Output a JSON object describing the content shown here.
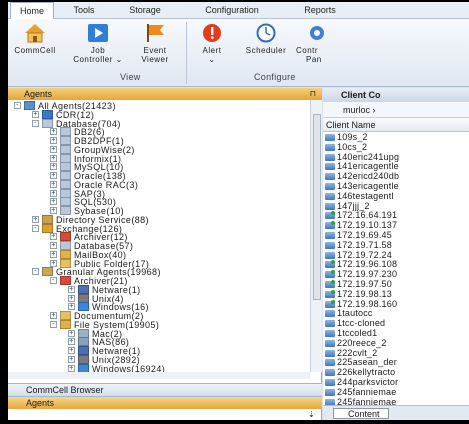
{
  "menu": [
    "Home",
    "Tools",
    "Storage",
    "Configuration",
    "Reports"
  ],
  "ribbon": {
    "buttons": [
      {
        "line1": "CommCell",
        "line2": "",
        "icon": "house-icon"
      },
      {
        "line1": "Job",
        "line2": "Controller ⌄",
        "icon": "play-icon"
      },
      {
        "line1": "Event",
        "line2": "Viewer",
        "icon": "flag-icon"
      },
      {
        "line1": "Alert",
        "line2": "⌄",
        "icon": "alert-icon"
      },
      {
        "line1": "Scheduler",
        "line2": "",
        "icon": "clock-icon"
      },
      {
        "line1": "Contr",
        "line2": "Pan",
        "icon": "gear-icon"
      }
    ],
    "groups": [
      "View",
      "Configure"
    ]
  },
  "left_pane": {
    "title": "Agents",
    "tree": [
      {
        "label": "All Agents(21423)",
        "level": 0,
        "exp": "-",
        "icon": "agents-icon"
      },
      {
        "label": "CDR(12)",
        "level": 1,
        "exp": "+",
        "icon": "cdr-icon"
      },
      {
        "label": "Database(704)",
        "level": 1,
        "exp": "-",
        "icon": "database-icon"
      },
      {
        "label": "DB2(6)",
        "level": 2,
        "exp": "+",
        "icon": "database-icon"
      },
      {
        "label": "DB2DPF(1)",
        "level": 2,
        "exp": "+",
        "icon": "database-icon"
      },
      {
        "label": "GroupWise(2)",
        "level": 2,
        "exp": "+",
        "icon": "database-icon"
      },
      {
        "label": "Informix(1)",
        "level": 2,
        "exp": "+",
        "icon": "database-icon"
      },
      {
        "label": "MySQL(10)",
        "level": 2,
        "exp": "+",
        "icon": "database-icon"
      },
      {
        "label": "Oracle(138)",
        "level": 2,
        "exp": "+",
        "icon": "database-icon"
      },
      {
        "label": "Oracle RAC(3)",
        "level": 2,
        "exp": "+",
        "icon": "database-icon"
      },
      {
        "label": "SAP(3)",
        "level": 2,
        "exp": "+",
        "icon": "database-icon"
      },
      {
        "label": "SQL(530)",
        "level": 2,
        "exp": "+",
        "icon": "database-icon"
      },
      {
        "label": "Sybase(10)",
        "level": 2,
        "exp": "+",
        "icon": "database-icon"
      },
      {
        "label": "Directory Service(88)",
        "level": 1,
        "exp": "+",
        "icon": "directory-icon"
      },
      {
        "label": "Exchange(126)",
        "level": 1,
        "exp": "-",
        "icon": "exchange-icon"
      },
      {
        "label": "Archiver(12)",
        "level": 2,
        "exp": "+",
        "icon": "archiver-icon"
      },
      {
        "label": "Database(57)",
        "level": 2,
        "exp": "+",
        "icon": "database-icon"
      },
      {
        "label": "MailBox(40)",
        "level": 2,
        "exp": "+",
        "icon": "mailbox-icon"
      },
      {
        "label": "Public Folder(17)",
        "level": 2,
        "exp": "+",
        "icon": "folder-icon"
      },
      {
        "label": "Granular Agents(19968)",
        "level": 1,
        "exp": "-",
        "icon": "granular-icon"
      },
      {
        "label": "Archiver(21)",
        "level": 2,
        "exp": "-",
        "icon": "archiver-icon"
      },
      {
        "label": "Netware(1)",
        "level": 3,
        "exp": "+",
        "icon": "netware-icon"
      },
      {
        "label": "Unix(4)",
        "level": 3,
        "exp": "+",
        "icon": "unix-icon"
      },
      {
        "label": "Windows(16)",
        "level": 3,
        "exp": "+",
        "icon": "windows-icon"
      },
      {
        "label": "Documentum(2)",
        "level": 2,
        "exp": "+",
        "icon": "folder-icon"
      },
      {
        "label": "File System(19905)",
        "level": 2,
        "exp": "-",
        "icon": "filesystem-icon"
      },
      {
        "label": "Mac(2)",
        "level": 3,
        "exp": "+",
        "icon": "mac-icon"
      },
      {
        "label": "NAS(86)",
        "level": 3,
        "exp": "+",
        "icon": "nas-icon"
      },
      {
        "label": "Netware(1)",
        "level": 3,
        "exp": "+",
        "icon": "netware-icon"
      },
      {
        "label": "Unix(2892)",
        "level": 3,
        "exp": "+",
        "icon": "unix-icon"
      },
      {
        "label": "Windows(16924)",
        "level": 3,
        "exp": "+",
        "icon": "windows-icon"
      }
    ],
    "bottom_tabs": [
      "CommCell Browser",
      "Agents"
    ]
  },
  "right_pane": {
    "title": "Client Co",
    "breadcrumb": "murloc ›",
    "column": "Client Name",
    "clients": [
      {
        "name": "109s_2",
        "online": false
      },
      {
        "name": "10cs_2",
        "online": false
      },
      {
        "name": "140eric241upg",
        "online": false
      },
      {
        "name": "141ericagentle",
        "online": false
      },
      {
        "name": "142ericd240db",
        "online": false
      },
      {
        "name": "143ericagentle",
        "online": false
      },
      {
        "name": "146testagentl",
        "online": false
      },
      {
        "name": "147jjj_2",
        "online": false
      },
      {
        "name": "172.16.64.191",
        "online": true
      },
      {
        "name": "172.19.10.137",
        "online": true
      },
      {
        "name": "172.19.69.45",
        "online": false
      },
      {
        "name": "172.19.71.58",
        "online": false
      },
      {
        "name": "172.19.72.24",
        "online": false
      },
      {
        "name": "172.19.96.108",
        "online": true
      },
      {
        "name": "172.19.97.230",
        "online": true
      },
      {
        "name": "172.19.97.50",
        "online": true
      },
      {
        "name": "172.19.98.13",
        "online": true
      },
      {
        "name": "172.19.98.160",
        "online": true
      },
      {
        "name": "1tautocc",
        "online": false
      },
      {
        "name": "1tcc-cloned",
        "online": false
      },
      {
        "name": "1tccoled1",
        "online": false
      },
      {
        "name": "220reece_2",
        "online": false
      },
      {
        "name": "222cvlt_2",
        "online": false
      },
      {
        "name": "225asean_der",
        "online": false
      },
      {
        "name": "226kellytracto",
        "online": false
      },
      {
        "name": "244parksvictor",
        "online": false
      },
      {
        "name": "245fanniemae",
        "online": false
      },
      {
        "name": "245fanniemae",
        "online": false
      }
    ],
    "footer_tab": "Content"
  },
  "colors": {
    "accent_header": "#e6a53a",
    "ribbon_bg": "#dfe7f2",
    "pane_border": "#93a6c0"
  }
}
